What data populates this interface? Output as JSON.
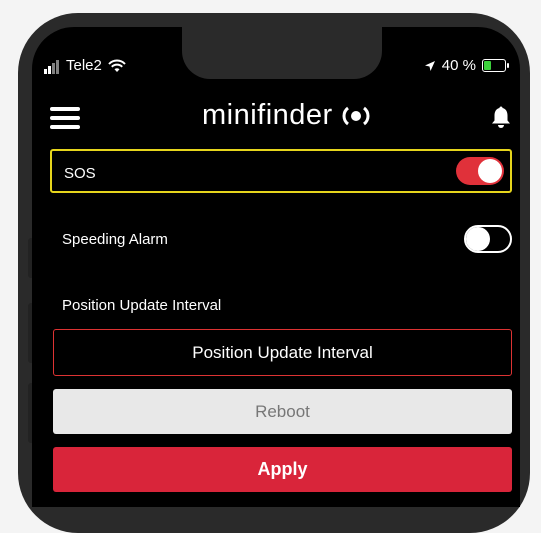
{
  "status": {
    "carrier": "Tele2",
    "battery_text": "40 %",
    "battery_level": 0.4,
    "battery_color": "#3cd03c"
  },
  "appbar": {
    "brand": "minifinder"
  },
  "settings": {
    "sos": {
      "label": "SOS",
      "enabled": true
    },
    "speeding": {
      "label": "Speeding Alarm",
      "enabled": false
    },
    "interval_label": "Position Update Interval"
  },
  "buttons": {
    "interval": "Position Update Interval",
    "reboot": "Reboot",
    "apply": "Apply"
  },
  "colors": {
    "highlight": "#e6d51c",
    "accent": "#d9253a"
  }
}
